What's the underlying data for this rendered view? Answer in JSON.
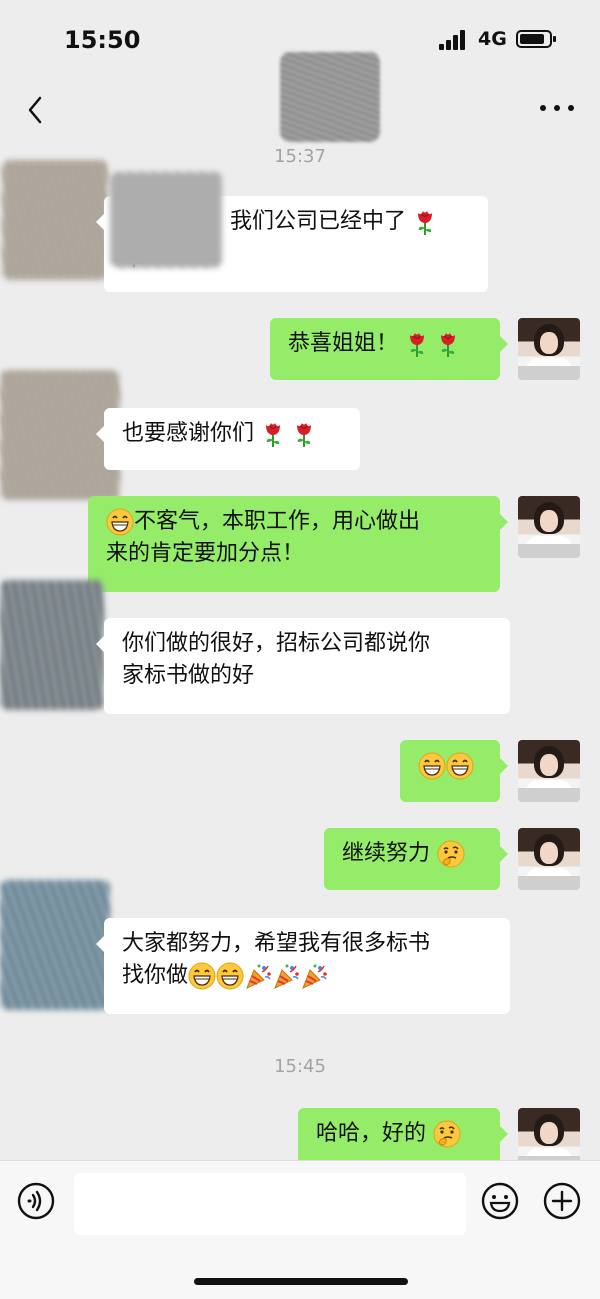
{
  "status_bar": {
    "time": "15:50",
    "network": "4G"
  },
  "nav": {
    "back_icon": "chevron-left-icon",
    "more_icon": "more-dots-icon"
  },
  "timestamps": [
    "15:37",
    "15:45"
  ],
  "messages": [
    {
      "side": "in",
      "text": "我们公司已经中了",
      "emojis": [
        "rose",
        "rose"
      ]
    },
    {
      "side": "out",
      "text": "恭喜姐姐！",
      "emojis": [
        "rose",
        "rose"
      ]
    },
    {
      "side": "in",
      "text": "也要感谢你们",
      "emojis": [
        "rose",
        "rose"
      ]
    },
    {
      "side": "out",
      "text_line1": "不客气，本职工作，用心做出",
      "text_line2": "来的肯定要加分点！",
      "emojis": [
        "grin"
      ]
    },
    {
      "side": "in",
      "text_line1": "你们做的很好，招标公司都说你",
      "text_line2": "家标书做的好"
    },
    {
      "side": "out",
      "text": "",
      "emojis": [
        "grin",
        "grin"
      ]
    },
    {
      "side": "out",
      "text": "继续努力",
      "emojis": [
        "thinking"
      ]
    },
    {
      "side": "in",
      "text_line1": "大家都努力，希望我有很多标书",
      "text_line2": "找你做",
      "emojis": [
        "grin",
        "grin",
        "party",
        "party",
        "party"
      ]
    },
    {
      "side": "out",
      "text": "哈哈，好的",
      "emojis": [
        "thinking"
      ]
    }
  ],
  "input_bar": {
    "placeholder": "",
    "voice_icon": "voice-icon",
    "emoji_icon": "smiley-icon",
    "plus_icon": "plus-icon"
  },
  "colors": {
    "background": "#ededed",
    "outgoing_bubble": "#95ec69",
    "incoming_bubble": "#ffffff"
  }
}
